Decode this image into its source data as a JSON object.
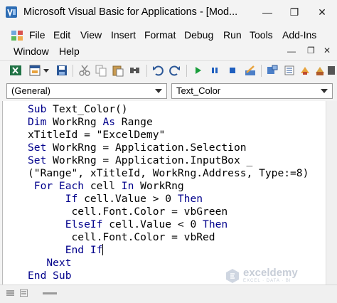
{
  "window": {
    "title": "Microsoft Visual Basic for Applications - [Mod...",
    "controls": {
      "minimize": "—",
      "restore": "❐",
      "close": "✕"
    }
  },
  "menu": {
    "file": "File",
    "edit": "Edit",
    "view": "View",
    "insert": "Insert",
    "format": "Format",
    "debug": "Debug",
    "run": "Run",
    "tools": "Tools",
    "addins": "Add-Ins",
    "window": "Window",
    "help": "Help"
  },
  "toolbar": {
    "icons": [
      "excel-view-icon",
      "insert-userform-icon",
      "dropdown-arrow-icon",
      "save-icon",
      "cut-icon",
      "copy-icon",
      "paste-icon",
      "find-icon",
      "undo-icon",
      "redo-icon",
      "run-icon",
      "break-icon",
      "reset-icon",
      "design-mode-icon",
      "project-explorer-icon",
      "properties-window-icon",
      "object-browser-icon",
      "toolbox-icon",
      "help-icon"
    ],
    "colors": {
      "run": "#1a9e3c",
      "pause": "#1f5fbf",
      "stop": "#1f5fbf",
      "excel": "#217346",
      "save": "#2b5797"
    }
  },
  "object_combo": {
    "value": "(General)"
  },
  "procedure_combo": {
    "value": "Text_Color"
  },
  "code": {
    "keyword_color": "#00008b",
    "lines": [
      {
        "kw": "Sub",
        "rest": " Text_Color()"
      },
      {
        "kw": "Dim",
        "rest": " WorkRng ",
        "kw2": "As",
        "rest2": " Range"
      },
      {
        "kw": "",
        "rest": "xTitleId = \"ExcelDemy\""
      },
      {
        "kw": "Set",
        "rest": " WorkRng = Application.Selection"
      },
      {
        "kw": "Set",
        "rest": " WorkRng = Application.InputBox _"
      },
      {
        "kw": "",
        "rest": "(\"Range\", xTitleId, WorkRng.Address, Type:=8)"
      },
      {
        "kw": " For Each",
        "rest": " cell ",
        "kw2": "In",
        "rest2": " WorkRng"
      },
      {
        "kw": "      If",
        "rest": " cell.Value > 0 ",
        "kw2": "Then",
        "rest2": ""
      },
      {
        "kw": "",
        "rest": "       cell.Font.Color = vbGreen"
      },
      {
        "kw": "      ElseIf",
        "rest": " cell.Value < 0 ",
        "kw2": "Then",
        "rest2": ""
      },
      {
        "kw": "",
        "rest": "       cell.Font.Color = vbRed"
      },
      {
        "kw": "      End If",
        "rest": ""
      },
      {
        "kw": "   Next",
        "rest": ""
      },
      {
        "kw": "End Sub",
        "rest": ""
      }
    ]
  },
  "watermark": {
    "name": "exceldemy",
    "tagline": "EXCEL · DATA · BI"
  }
}
